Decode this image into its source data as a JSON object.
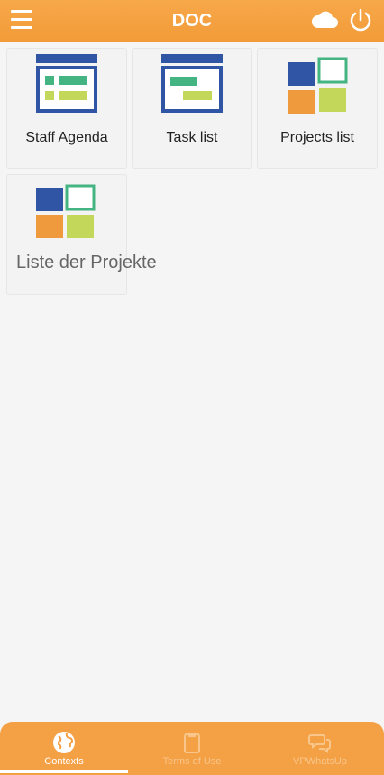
{
  "header": {
    "title": "DOC",
    "menu_icon": "hamburger-menu-icon",
    "cloud_icon": "cloud-icon",
    "power_icon": "power-icon"
  },
  "tiles": [
    {
      "label": "Staff Agenda",
      "icon": "agenda-icon"
    },
    {
      "label": "Task list",
      "icon": "task-list-icon"
    },
    {
      "label": "Projects list",
      "icon": "projects-grid-icon"
    },
    {
      "label": "Liste der Projekte",
      "icon": "projects-grid-icon"
    }
  ],
  "bottom_nav": [
    {
      "label": "Contexts",
      "icon": "globe-icon",
      "active": true
    },
    {
      "label": "Terms of Use",
      "icon": "clipboard-icon",
      "active": false
    },
    {
      "label": "VPWhatsUp",
      "icon": "chat-bubbles-icon",
      "active": false
    }
  ],
  "colors": {
    "accent": "#f29b38",
    "blue": "#2f55a4",
    "green": "#44b482",
    "orange": "#ef9a3d",
    "lime": "#c3d85a"
  }
}
